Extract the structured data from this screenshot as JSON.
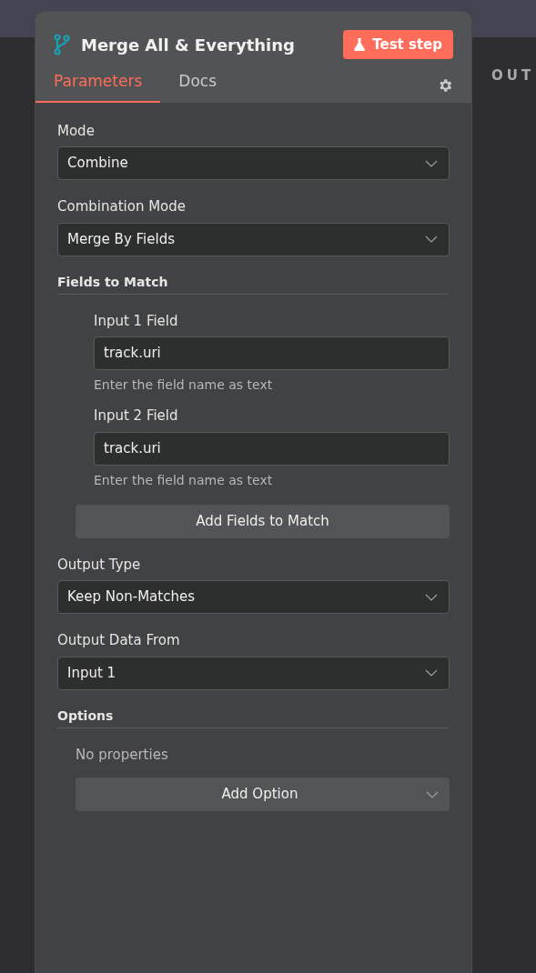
{
  "panel": {
    "title": "Merge All & Everything",
    "test_button": "Test step",
    "tabs": [
      {
        "label": "Parameters",
        "selected": true
      },
      {
        "label": "Docs",
        "selected": false
      }
    ]
  },
  "parameters": [
    {
      "kind": "select",
      "label": "Mode",
      "value": "Combine"
    },
    {
      "kind": "select",
      "label": "Combination Mode",
      "value": "Merge By Fields"
    },
    {
      "kind": "collection",
      "label": "Fields to Match",
      "fields": [
        {
          "label": "Input 1 Field",
          "value": "track.uri",
          "hint": "Enter the field name as text"
        },
        {
          "label": "Input 2 Field",
          "value": "track.uri",
          "hint": "Enter the field name as text"
        }
      ],
      "button": "Add Fields to Match"
    },
    {
      "kind": "select",
      "label": "Output Type",
      "value": "Keep Non-Matches"
    },
    {
      "kind": "select",
      "label": "Output Data From",
      "value": "Input 1"
    },
    {
      "kind": "options",
      "label": "Options",
      "empty_text": "No properties",
      "button": "Add Option"
    }
  ],
  "side_heading": "OUT"
}
